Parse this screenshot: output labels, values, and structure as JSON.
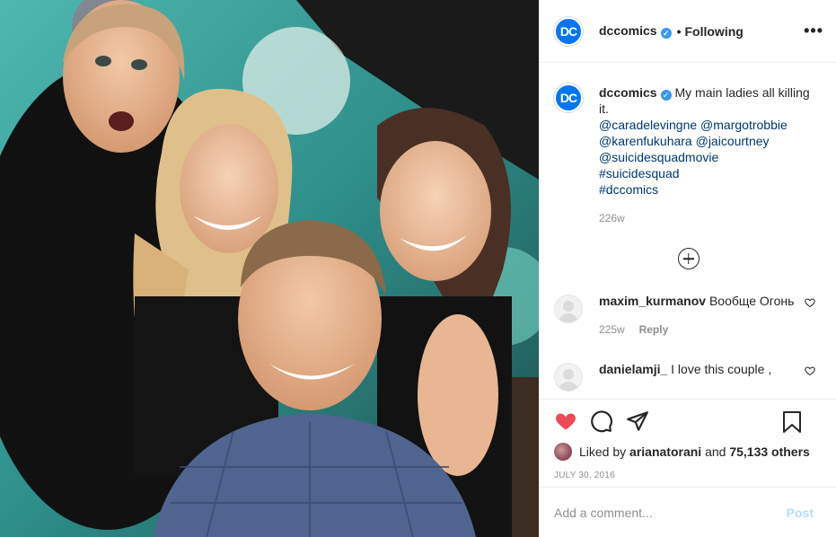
{
  "post": {
    "username": "dccomics",
    "logo_text": "DC",
    "follow_status": "Following",
    "more_icon": "more-dots-icon",
    "caption": {
      "username": "dccomics",
      "text": "My main ladies all killing it.",
      "tags": [
        "@caradelevingne @margotrobbie",
        "@karenfukuhara @jaicourtney",
        "@suicidesquadmovie",
        "#suicidesquad",
        "#dccomics"
      ],
      "time": "226w"
    },
    "comments": [
      {
        "username": "maxim_kurmanov",
        "text": "Вообще Огонь",
        "time": "225w",
        "reply_label": "Reply"
      },
      {
        "username": "danielamji_",
        "text": "I love this couple ,"
      }
    ],
    "likes": {
      "prefix": "Liked by",
      "user": "ariana torani",
      "and": "and",
      "count": "75,133 others"
    },
    "date": "JULY 30, 2016",
    "add_comment_placeholder": "Add a comment...",
    "post_label": "Post"
  },
  "colors": {
    "like_red": "#ed4956",
    "dc_blue": "#0476f2",
    "link_blue": "#00376b",
    "post_button": "#b2dffc"
  }
}
